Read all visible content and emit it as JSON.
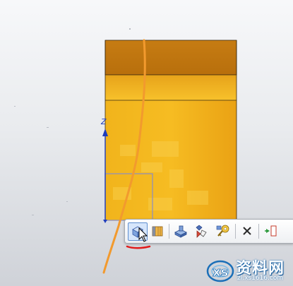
{
  "viewport": {
    "axis_z_label": "Z",
    "colors": {
      "background_top": "#f7f8fa",
      "background_bottom": "#cfd2d8",
      "part_top_face": "#c47a12",
      "part_side_face": "#f3b51c",
      "edge_line": "#3a2a10",
      "axis_color": "#1f3dbb",
      "annotation_stroke": "#f29a2e",
      "annotation_underline": "#e11b1b"
    }
  },
  "toolbar": {
    "buttons": [
      {
        "name": "extrude",
        "icon": "extrude-box-icon",
        "active": true
      },
      {
        "name": "revolve",
        "icon": "revolve-icon"
      },
      {
        "name": "shell",
        "icon": "shell-icon"
      },
      {
        "name": "draft",
        "icon": "draft-icon"
      },
      {
        "name": "properties",
        "icon": "properties-key-icon"
      },
      {
        "name": "delete",
        "icon": "delete-x-icon"
      },
      {
        "name": "move",
        "icon": "move-arrow-icon"
      }
    ]
  },
  "watermark": {
    "text": "资料网",
    "url": "zl.xs1616.com",
    "icon": "xs-logo-icon"
  }
}
